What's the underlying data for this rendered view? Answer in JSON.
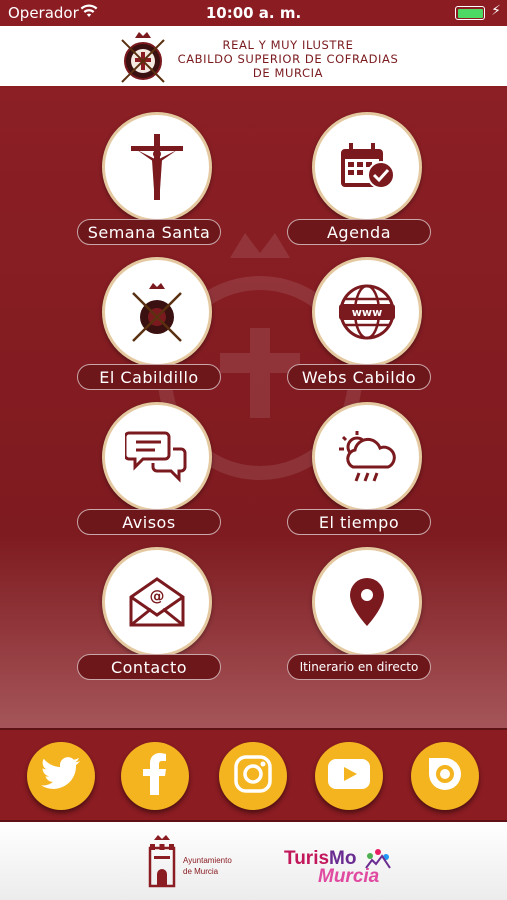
{
  "status_bar": {
    "carrier": "Operador",
    "time": "10:00 a. m."
  },
  "header": {
    "line1": "REAL Y MUY ILUSTRE",
    "line2": "CABILDO SUPERIOR DE COFRADIAS",
    "line3": "DE MURCIA"
  },
  "menu": {
    "semana_santa": "Semana Santa",
    "agenda": "Agenda",
    "cabildillo": "El Cabildillo",
    "webs": "Webs Cabildo",
    "avisos": "Avisos",
    "tiempo": "El tiempo",
    "contacto": "Contacto",
    "itinerario": "Itinerario en directo"
  },
  "social": [
    "twitter-icon",
    "facebook-icon",
    "instagram-icon",
    "youtube-icon",
    "issuu-icon"
  ],
  "footer": {
    "ayuntamiento_line1": "Ayuntamiento",
    "ayuntamiento_line2": "de Murcia",
    "turismo_part1": "Turis",
    "turismo_part2": "Mo",
    "turismo_part3": "Murcia"
  },
  "colors": {
    "primary": "#8a1c22",
    "accent": "#f4b41f",
    "icon": "#7a1a1e"
  }
}
